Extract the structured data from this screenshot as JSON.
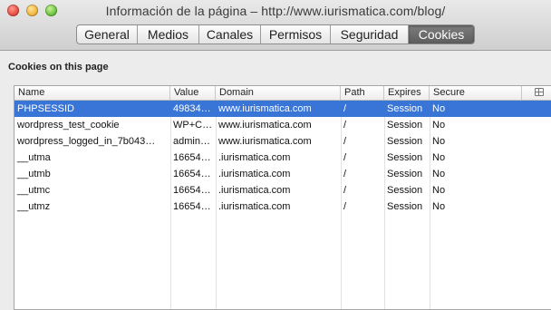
{
  "window": {
    "title": "Información de la página – http://www.iurismatica.com/blog/"
  },
  "tabs": [
    {
      "label": "General",
      "active": false
    },
    {
      "label": "Medios",
      "active": false
    },
    {
      "label": "Canales",
      "active": false
    },
    {
      "label": "Permisos",
      "active": false
    },
    {
      "label": "Seguridad",
      "active": false
    },
    {
      "label": "Cookies",
      "active": true
    }
  ],
  "section": {
    "heading": "Cookies on this page"
  },
  "table": {
    "columns": [
      "Name",
      "Value",
      "Domain",
      "Path",
      "Expires",
      "Secure"
    ],
    "rows": [
      {
        "name": "PHPSESSID",
        "value": "49834…",
        "domain": "www.iurismatica.com",
        "path": "/",
        "expires": "Session",
        "secure": "No",
        "selected": true
      },
      {
        "name": "wordpress_test_cookie",
        "value": "WP+C…",
        "domain": "www.iurismatica.com",
        "path": "/",
        "expires": "Session",
        "secure": "No",
        "selected": false
      },
      {
        "name": "wordpress_logged_in_7b043…",
        "value": "admin…",
        "domain": "www.iurismatica.com",
        "path": "/",
        "expires": "Session",
        "secure": "No",
        "selected": false
      },
      {
        "name": "__utma",
        "value": "16654…",
        "domain": ".iurismatica.com",
        "path": "/",
        "expires": "Session",
        "secure": "No",
        "selected": false
      },
      {
        "name": "__utmb",
        "value": "16654…",
        "domain": ".iurismatica.com",
        "path": "/",
        "expires": "Session",
        "secure": "No",
        "selected": false
      },
      {
        "name": "__utmc",
        "value": "16654…",
        "domain": ".iurismatica.com",
        "path": "/",
        "expires": "Session",
        "secure": "No",
        "selected": false
      },
      {
        "name": "__utmz",
        "value": "16654…",
        "domain": ".iurismatica.com",
        "path": "/",
        "expires": "Session",
        "secure": "No",
        "selected": false
      }
    ]
  },
  "colors": {
    "selection": "#3875d7",
    "active_tab": "#6b6b6b"
  }
}
